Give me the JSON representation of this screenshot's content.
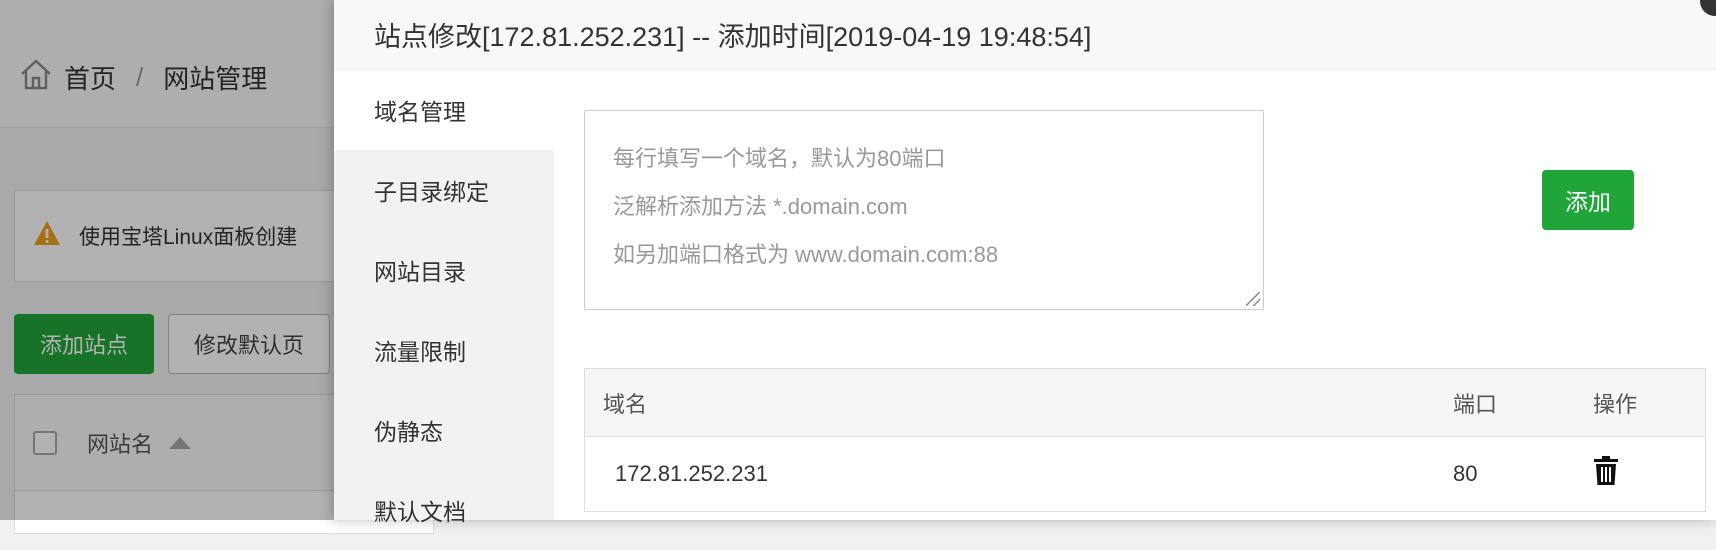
{
  "background": {
    "breadcrumb": {
      "home": "首页",
      "separator": "/",
      "current": "网站管理"
    },
    "notice_text": "使用宝塔Linux面板创建",
    "add_site_label": "添加站点",
    "modify_default_label": "修改默认页",
    "table_col_site_name": "网站名"
  },
  "dialog": {
    "title": "站点修改[172.81.252.231] -- 添加时间[2019-04-19 19:48:54]",
    "menu": [
      {
        "label": "域名管理"
      },
      {
        "label": "子目录绑定"
      },
      {
        "label": "网站目录"
      },
      {
        "label": "流量限制"
      },
      {
        "label": "伪静态"
      },
      {
        "label": "默认文档"
      }
    ],
    "domain_input": {
      "placeholder_lines": [
        "每行填写一个域名，默认为80端口",
        "泛解析添加方法 *.domain.com",
        "如另加端口格式为 www.domain.com:88"
      ]
    },
    "add_button_label": "添加",
    "table": {
      "headers": {
        "domain": "域名",
        "port": "端口",
        "action": "操作"
      },
      "rows": [
        {
          "domain": "172.81.252.231",
          "port": "80"
        }
      ]
    }
  },
  "colors": {
    "accent_green": "#20a53a"
  },
  "icons": {
    "home": "home-icon",
    "warning": "warning-icon",
    "delete": "trash-icon"
  }
}
